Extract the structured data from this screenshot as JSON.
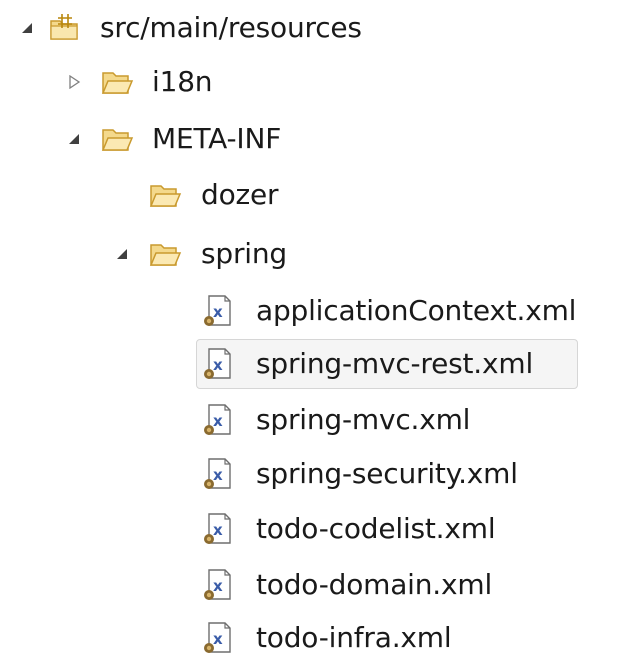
{
  "tree": {
    "items": [
      {
        "label": "src/main/resources",
        "expanded": true,
        "icon": "package-folder-icon"
      },
      {
        "label": "i18n",
        "expanded": false,
        "icon": "folder-icon"
      },
      {
        "label": "META-INF",
        "expanded": true,
        "icon": "folder-icon"
      },
      {
        "label": "dozer",
        "icon": "folder-icon"
      },
      {
        "label": "spring",
        "expanded": true,
        "icon": "folder-icon"
      },
      {
        "label": "applicationContext.xml",
        "icon": "spring-xml-file-icon"
      },
      {
        "label": "spring-mvc-rest.xml",
        "icon": "spring-xml-file-icon",
        "selected": true
      },
      {
        "label": "spring-mvc.xml",
        "icon": "spring-xml-file-icon"
      },
      {
        "label": "spring-security.xml",
        "icon": "spring-xml-file-icon"
      },
      {
        "label": "todo-codelist.xml",
        "icon": "spring-xml-file-icon"
      },
      {
        "label": "todo-domain.xml",
        "icon": "spring-xml-file-icon"
      },
      {
        "label": "todo-infra.xml",
        "icon": "spring-xml-file-icon"
      }
    ]
  },
  "colors": {
    "folder_fill": "#f4d98c",
    "folder_stroke": "#c99a2e",
    "selection_bg": "#f5f5f5",
    "selection_border": "#d6d6d6",
    "xml_accent": "#3a5ca8",
    "spring_leaf": "#8a6a2f"
  }
}
